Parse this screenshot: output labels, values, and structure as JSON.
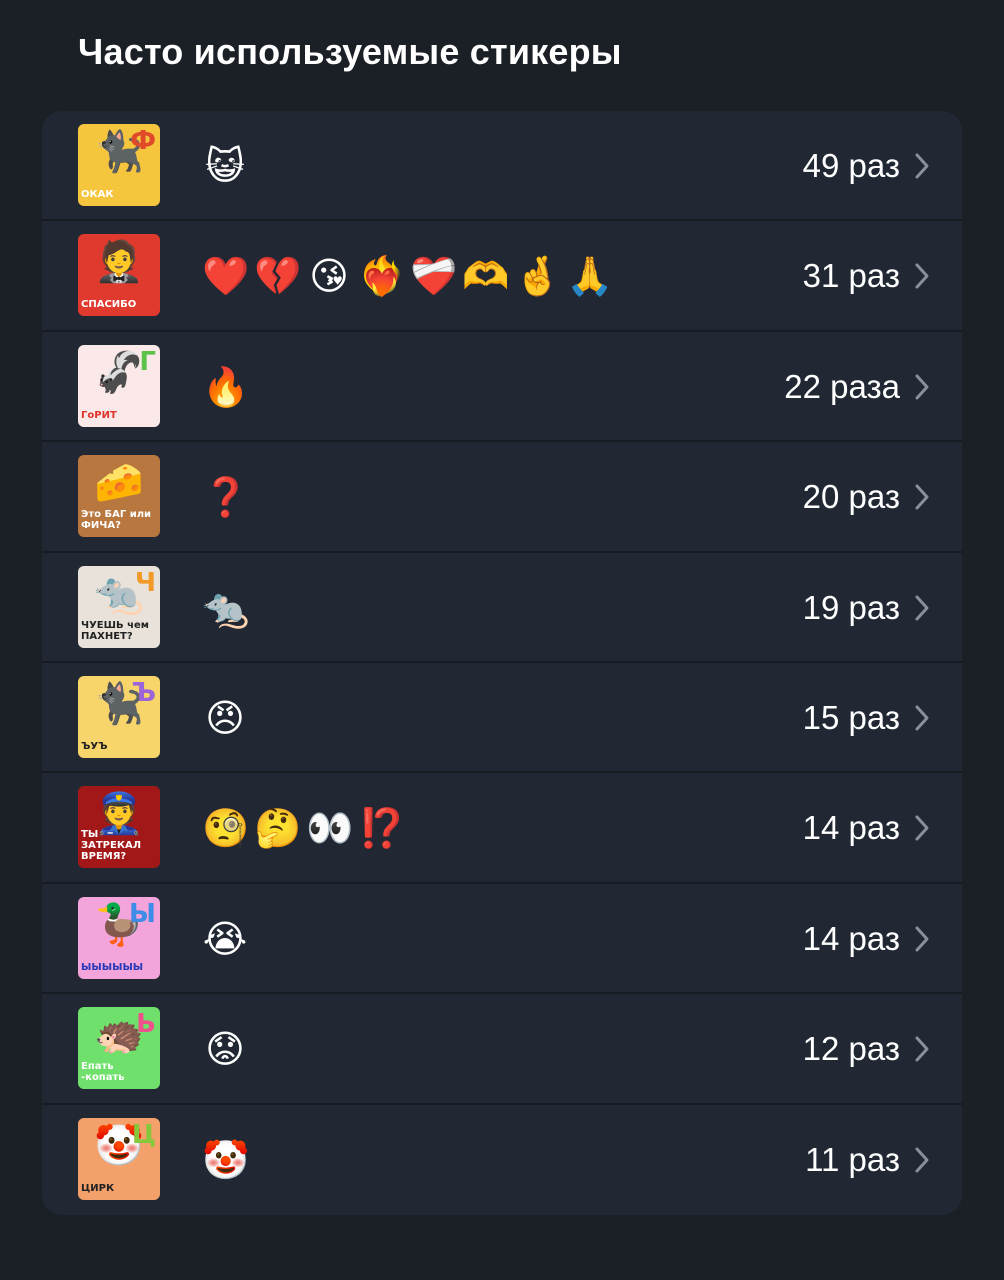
{
  "title": "Часто используемые стикеры",
  "items": [
    {
      "thumb_bg": "#f6c53e",
      "thumb_caption": "ОКАК",
      "thumb_caption_color": "#ffffff",
      "thumb_glyph": "Ф",
      "thumb_glyph_color": "#e04a2a",
      "thumb_figure": "black-cat-hoodie",
      "emojis": [
        "😺"
      ],
      "count": "49 раз"
    },
    {
      "thumb_bg": "#e03a2f",
      "thumb_caption": "СПАСИБО",
      "thumb_caption_color": "#ffffff",
      "thumb_glyph": "",
      "thumb_glyph_color": "#ffffff",
      "thumb_figure": "bowing-gentleman",
      "emojis": [
        "❤️",
        "💔",
        "😘",
        "❤️‍🔥",
        "❤️‍🩹",
        "🫶",
        "🤞",
        "🙏"
      ],
      "count": "31 раз"
    },
    {
      "thumb_bg": "#fbe9ea",
      "thumb_caption": "ГоРИТ",
      "thumb_caption_color": "#e0342a",
      "thumb_glyph": "Г",
      "thumb_glyph_color": "#5cc24a",
      "thumb_figure": "skunk-fire",
      "emojis": [
        "🔥"
      ],
      "count": "22 раза"
    },
    {
      "thumb_bg": "#b8773e",
      "thumb_caption": "Это БАГ или ФИЧА?",
      "thumb_caption_color": "#ffffff",
      "thumb_glyph": "",
      "thumb_glyph_color": "#ffffff",
      "thumb_figure": "blue-cheese",
      "emojis": [
        "❓"
      ],
      "count": "20 раз"
    },
    {
      "thumb_bg": "#e8e2da",
      "thumb_caption": "ЧУЕШЬ чем ПАХНЕТ?",
      "thumb_caption_color": "#222222",
      "thumb_glyph": "Ч",
      "thumb_glyph_color": "#f29a27",
      "thumb_figure": "rat-cheese",
      "emojis": [
        "🐀"
      ],
      "count": "19 раз"
    },
    {
      "thumb_bg": "#f7d56a",
      "thumb_caption": "ЪУЪ",
      "thumb_caption_color": "#222222",
      "thumb_glyph": "Ъ",
      "thumb_glyph_color": "#9b64d8",
      "thumb_figure": "black-cat-arms-up",
      "emojis": [
        "😠"
      ],
      "count": "15 раз"
    },
    {
      "thumb_bg": "#a21818",
      "thumb_caption": "ТЫ ЗАТРЕКАЛ ВРЕМЯ?",
      "thumb_caption_color": "#ffffff",
      "thumb_glyph": "",
      "thumb_glyph_color": "#ffffff",
      "thumb_figure": "police-binoculars",
      "emojis": [
        "🧐",
        "🤔",
        "👀",
        "⁉️"
      ],
      "count": "14 раз"
    },
    {
      "thumb_bg": "#f3a4da",
      "thumb_caption": "ЫЫЫЫЫЫ",
      "thumb_caption_color": "#2a3ab8",
      "thumb_glyph": "Ы",
      "thumb_glyph_color": "#3d8ce8",
      "thumb_figure": "crying-duck",
      "emojis": [
        "😭"
      ],
      "count": "14 раз"
    },
    {
      "thumb_bg": "#6ee06b",
      "thumb_caption": "Епать -копать",
      "thumb_caption_color": "#ffffff",
      "thumb_glyph": "Ь",
      "thumb_glyph_color": "#f0508c",
      "thumb_figure": "orange-hedgehog",
      "emojis": [
        "😟"
      ],
      "count": "12 раз"
    },
    {
      "thumb_bg": "#f4a06a",
      "thumb_caption": "ЦИРК",
      "thumb_caption_color": "#222222",
      "thumb_glyph": "Ц",
      "thumb_glyph_color": "#86c83c",
      "thumb_figure": "clown",
      "emojis": [
        "🤡"
      ],
      "count": "11 раз"
    }
  ]
}
